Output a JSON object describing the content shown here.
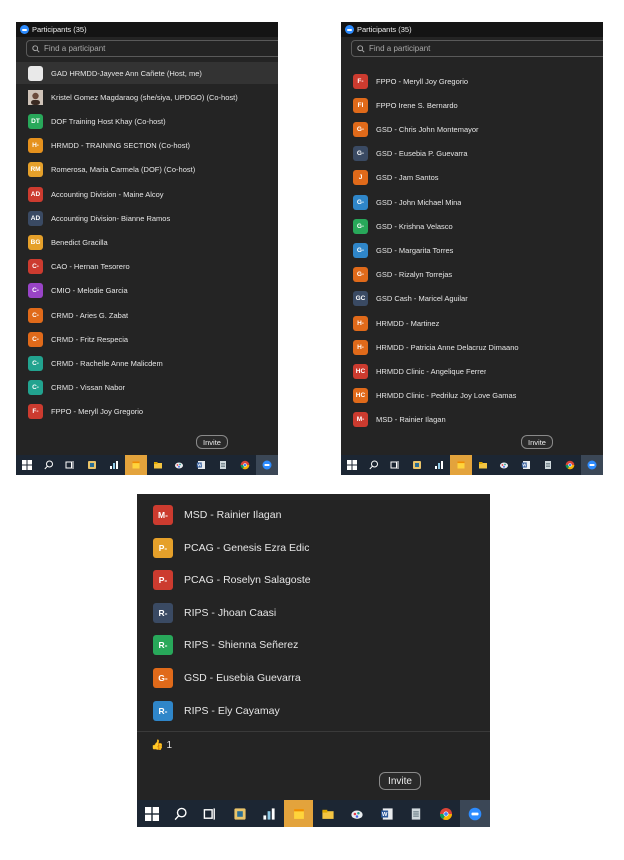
{
  "window_title": "Participants (35)",
  "search_placeholder": "Find a participant",
  "invite_label": "Invite",
  "reaction": {
    "emoji": "👍",
    "count": "1"
  },
  "panel1": [
    {
      "initials": "",
      "name": "GAD HRMDD-Jayvee Ann Cañete (Host, me)",
      "color": "#e9e9e9"
    },
    {
      "initials": "photo",
      "name": "Kristel Gomez Magdaraog (she/siya, UPDGO) (Co-host)",
      "color": "#8a6a5a"
    },
    {
      "initials": "DT",
      "name": "DOF Training Host Khay (Co-host)",
      "color": "#28a85a"
    },
    {
      "initials": "H-",
      "name": "HRMDD - TRAINING SECTION (Co-host)",
      "color": "#e5911d"
    },
    {
      "initials": "RM",
      "name": "Romerosa, Maria Carmela (DOF) (Co-host)",
      "color": "#e5a02a"
    },
    {
      "initials": "AD",
      "name": "Accounting Division - Maine Alcoy",
      "color": "#cc3b2f"
    },
    {
      "initials": "AD",
      "name": "Accounting Division- Bianne Ramos",
      "color": "#3a4a63"
    },
    {
      "initials": "BG",
      "name": "Benedict Gracilla",
      "color": "#e5a02a"
    },
    {
      "initials": "C-",
      "name": "CAO - Hernan Tesorero",
      "color": "#cc3b2f"
    },
    {
      "initials": "C-",
      "name": "CMIO - Melodie Garcia",
      "color": "#9944c7"
    },
    {
      "initials": "C-",
      "name": "CRMD - Aries G. Zabat",
      "color": "#e06a1a"
    },
    {
      "initials": "C-",
      "name": "CRMD - Fritz Respecia",
      "color": "#e06a1a"
    },
    {
      "initials": "C-",
      "name": "CRMD - Rachelle Anne Malicdem",
      "color": "#22a38f"
    },
    {
      "initials": "C-",
      "name": "CRMD - Vissan Nabor",
      "color": "#22a38f"
    },
    {
      "initials": "F-",
      "name": "FPPO - Meryll Joy Gregorio",
      "color": "#cc3b2f"
    }
  ],
  "panel2": [
    {
      "initials": "F-",
      "name": "FPPO - Meryll Joy Gregorio",
      "color": "#cc3b2f"
    },
    {
      "initials": "FI",
      "name": "FPPO Irene S. Bernardo",
      "color": "#e06a1a"
    },
    {
      "initials": "G-",
      "name": "GSD - Chris John Montemayor",
      "color": "#e06a1a"
    },
    {
      "initials": "G-",
      "name": "GSD - Eusebia P. Guevarra",
      "color": "#3a4a63"
    },
    {
      "initials": "J",
      "name": "GSD - Jam Santos",
      "color": "#e06a1a"
    },
    {
      "initials": "G-",
      "name": "GSD - John Michael Mina",
      "color": "#2f86c9"
    },
    {
      "initials": "G-",
      "name": "GSD - Krishna Velasco",
      "color": "#28a85a"
    },
    {
      "initials": "G-",
      "name": "GSD - Margarita Torres",
      "color": "#2f86c9"
    },
    {
      "initials": "G-",
      "name": "GSD - Rizalyn Torrejas",
      "color": "#e06a1a"
    },
    {
      "initials": "GC",
      "name": "GSD Cash - Maricel Aguilar",
      "color": "#3a4a63"
    },
    {
      "initials": "H-",
      "name": "HRMDD - Martinez",
      "color": "#e06a1a"
    },
    {
      "initials": "H-",
      "name": "HRMDD - Patricia Anne Delacruz Dimaano",
      "color": "#e06a1a"
    },
    {
      "initials": "HC",
      "name": "HRMDD Clinic - Angelique Ferrer",
      "color": "#cc3b2f"
    },
    {
      "initials": "HC",
      "name": "HRMDD Clinic - Pedriluz Joy Love Gamas",
      "color": "#e06a1a"
    },
    {
      "initials": "M-",
      "name": "MSD - Rainier Ilagan",
      "color": "#cc3b2f"
    }
  ],
  "panel3": [
    {
      "initials": "M-",
      "name": "MSD - Rainier Ilagan",
      "color": "#cc3b2f"
    },
    {
      "initials": "P-",
      "name": "PCAG - Genesis Ezra Edic",
      "color": "#e5a02a"
    },
    {
      "initials": "P-",
      "name": "PCAG - Roselyn Salagoste",
      "color": "#cc3b2f"
    },
    {
      "initials": "R-",
      "name": "RIPS - Jhoan Caasi",
      "color": "#3a4a63"
    },
    {
      "initials": "R-",
      "name": "RIPS - Shienna Señerez",
      "color": "#28a85a"
    },
    {
      "initials": "G-",
      "name": "GSD - Eusebia Guevarra",
      "color": "#e06a1a"
    },
    {
      "initials": "R-",
      "name": "RIPS - Ely Cayamay",
      "color": "#2f86c9"
    }
  ],
  "taskbar_icons": [
    "windows-start-icon",
    "search-icon",
    "task-view-icon",
    "calculator-app-icon",
    "chart-app-icon",
    "sticky-notes-icon",
    "file-explorer-icon",
    "paint-icon",
    "word-icon",
    "notepad-icon",
    "chrome-icon",
    "zoom-icon"
  ]
}
